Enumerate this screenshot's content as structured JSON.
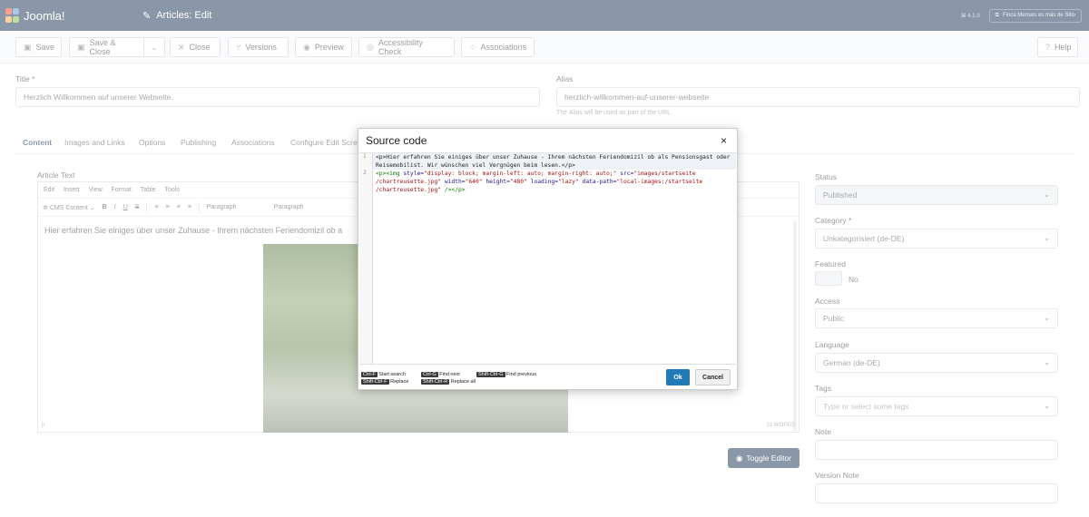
{
  "header": {
    "logo_text": "Joomla!",
    "page_title": "Articles: Edit",
    "version": "⌘ 4.1.0",
    "site_link": "Finca Menses es más de Sitio",
    "brand_color": "#132f53"
  },
  "toolbar": {
    "save": "Save",
    "save_close": "Save & Close",
    "close": "Close",
    "versions": "Versions",
    "preview": "Preview",
    "accessibility": "Accessibility Check",
    "associations": "Associations",
    "help": "Help"
  },
  "form": {
    "title_label": "Title *",
    "title_value": "Herzlich Willkommen auf unserer Webseite.",
    "alias_label": "Alias",
    "alias_value": "herzlich-willkommen-auf-unserer-webseite",
    "alias_hint": "The Alias will be used as part of the URL."
  },
  "tabs": [
    "Content",
    "Images and Links",
    "Options",
    "Publishing",
    "Associations",
    "Configure Edit Screen"
  ],
  "editor": {
    "label": "Article Text",
    "menu": [
      "Edit",
      "Insert",
      "View",
      "Format",
      "Table",
      "Tools"
    ],
    "cms_content": "CMS Content",
    "paragraph1": "Paragraph",
    "paragraph2": "Paragraph",
    "content_text": "Hier erfahren Sie einiges über unser Zuhause - Ihrem nächsten Feriendomizil ob a",
    "status_left": "p",
    "status_right": "21 WORDS",
    "toggle_label": "Toggle Editor"
  },
  "sidebar": {
    "status_label": "Status",
    "status_value": "Published",
    "category_label": "Category *",
    "category_value": "Unkategorisiert (de-DE)",
    "featured_label": "Featured",
    "featured_value": "No",
    "access_label": "Access",
    "access_value": "Public",
    "language_label": "Language",
    "language_value": "German (de-DE)",
    "tags_label": "Tags",
    "tags_placeholder": "Type or select some tags",
    "note_label": "Note",
    "version_note_label": "Version Note"
  },
  "modal": {
    "title": "Source code",
    "close": "×",
    "lines": [
      "1",
      "2"
    ],
    "code_line1a": "<p>Hier erfahren Sie einiges über unser Zuhause - Ihrem nächsten Feriendomizil ob als Pensionsgast oder",
    "code_line1b": "Reisemobilist. Wir wünschen viel Vergnügen beim lesen.</p>",
    "code_line2a_tag": "<p><img ",
    "code_line2a_attr1": "style=",
    "code_line2a_val1": "\"display: block; margin-left: auto; margin-right: auto;\"",
    "code_line2a_attr2": " src=",
    "code_line2a_val2": "\"images/startseite",
    "code_line2b_val2": "/chartreusette.jpg\"",
    "code_line2b_attr3": " width=",
    "code_line2b_val3": "\"640\"",
    "code_line2b_attr4": " height=",
    "code_line2b_val4": "\"480\"",
    "code_line2b_attr5": " loading=",
    "code_line2b_val5": "\"lazy\"",
    "code_line2b_attr6": " data-path=",
    "code_line2b_val6": "\"local-images:/startseite",
    "code_line2c_val6": "/chartreusette.jpg\"",
    "code_line2c_tag": " /></p>",
    "sc1_key": "Ctrl-F",
    "sc1_text": "Start search",
    "sc2_key": "Ctrl-G",
    "sc2_text": "Find next",
    "sc3_key": "Shift-Ctrl-G",
    "sc3_text": "Find previous",
    "sc4_key": "Shift-Ctrl-F",
    "sc4_text": "Replace",
    "sc5_key": "Shift-Ctrl-R",
    "sc5_text": "Replace all",
    "ok": "Ok",
    "cancel": "Cancel"
  }
}
